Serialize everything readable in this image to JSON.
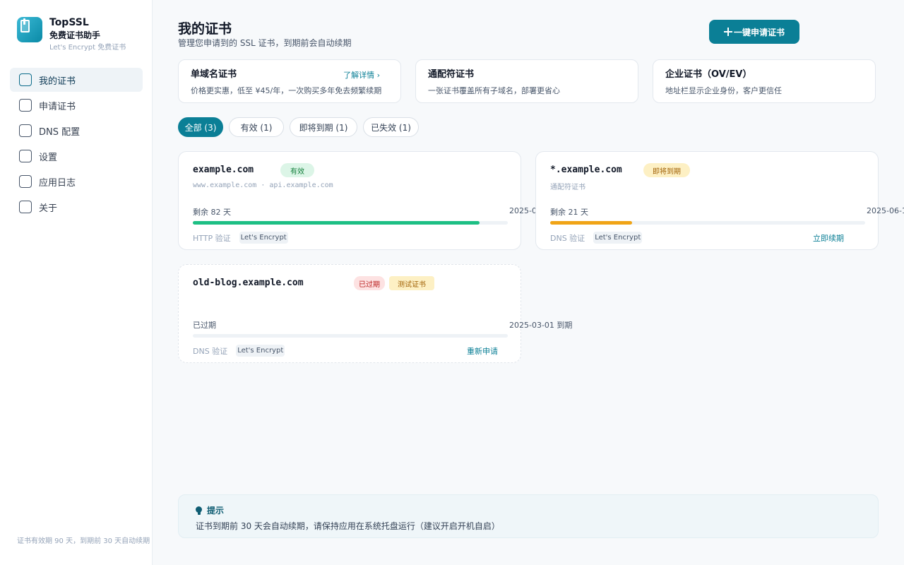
{
  "app": {
    "name": "TopSSL",
    "subtitle": "免费证书助手",
    "tagline": "Let's Encrypt 免费证书"
  },
  "sidebar": {
    "items": [
      {
        "label": "我的证书",
        "icon": "square-icon",
        "active": true
      },
      {
        "label": "申请证书",
        "icon": "square-icon",
        "active": false
      },
      {
        "label": "DNS 配置",
        "icon": "square-icon",
        "active": false
      },
      {
        "label": "设置",
        "icon": "square-icon",
        "active": false
      },
      {
        "label": "应用日志",
        "icon": "square-icon",
        "active": false
      },
      {
        "label": "关于",
        "icon": "square-icon",
        "active": false
      }
    ],
    "footer": "证书有效期 90 天，到期前 30 天自动续期"
  },
  "header": {
    "title": "我的证书",
    "subtitle": "管理您申请到的 SSL 证书，到期前会自动续期",
    "primary_button": "一键申请证书"
  },
  "promos": [
    {
      "title": "单域名证书",
      "desc": "价格更实惠，低至 ¥45/年，一次购买多年免去频繁续期",
      "link": "了解详情 ›"
    },
    {
      "title": "通配符证书",
      "desc": "一张证书覆盖所有子域名，部署更省心"
    },
    {
      "title": "企业证书（OV/EV）",
      "desc": "地址栏显示企业身份，客户更信任"
    }
  ],
  "filters": [
    {
      "label": "全部 (3)",
      "active": true
    },
    {
      "label": "有效 (1)",
      "active": false
    },
    {
      "label": "即将到期 (1)",
      "active": false
    },
    {
      "label": "已失效 (1)",
      "active": false
    }
  ],
  "certificates": [
    {
      "domain": "example.com",
      "status": "有效",
      "sans": "www.example.com · api.example.com",
      "remaining": "剩余 82 天",
      "expiry": "2025-0",
      "progress": 0.91,
      "method": "HTTP 验证",
      "ca": "Let's Encrypt"
    },
    {
      "domain": "*.example.com",
      "status": "即将到期",
      "subtitle": "通配符证书",
      "remaining": "剩余 21 天",
      "expiry": "2025-06-1",
      "progress": 0.26,
      "method": "DNS 验证",
      "ca": "Let's Encrypt",
      "action": "立即续期"
    },
    {
      "domain": "old-blog.example.com",
      "status": "已过期",
      "test_badge": "测试证书",
      "remaining": "已过期",
      "expiry": "2025-03-01 到期",
      "progress": 0,
      "method": "DNS 验证",
      "ca": "Let's Encrypt",
      "action": "重新申请"
    }
  ],
  "tip": {
    "title": "提示",
    "text": "证书到期前 30 天会自动续期，请保持应用在系统托盘运行（建议开启开机自启）"
  },
  "colors": {
    "accent": "#0b7f96",
    "valid": "#1dbf84",
    "warning": "#f0a416",
    "expired": "#b91c1c"
  }
}
